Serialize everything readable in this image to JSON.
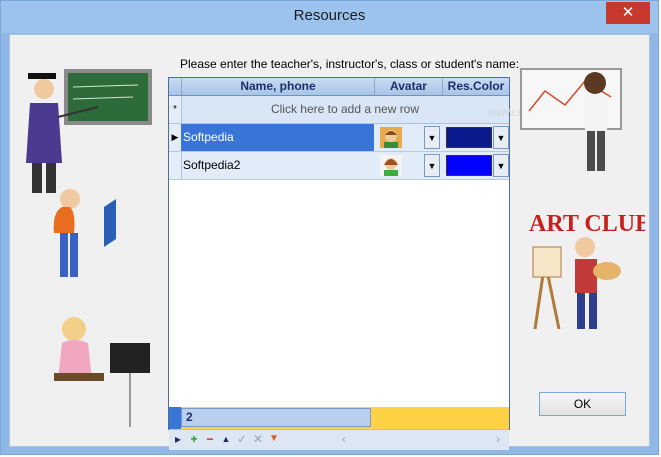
{
  "window": {
    "title": "Resources",
    "close_label": "✕"
  },
  "prompt": "Please enter the teacher's, instructor's, class or student's name:",
  "grid": {
    "columns": [
      "Name, phone",
      "Avatar",
      "Res.Color"
    ],
    "new_row_text": "Click here to add a new row",
    "new_row_marker": "*",
    "rows": [
      {
        "name": "Softpedia",
        "color": "#0a1a8c",
        "selected": true
      },
      {
        "name": "Softpedia2",
        "color": "#0000ff",
        "selected": false
      }
    ],
    "row_count": "2"
  },
  "ok_label": "OK",
  "watermark": "www.softpedia.com"
}
